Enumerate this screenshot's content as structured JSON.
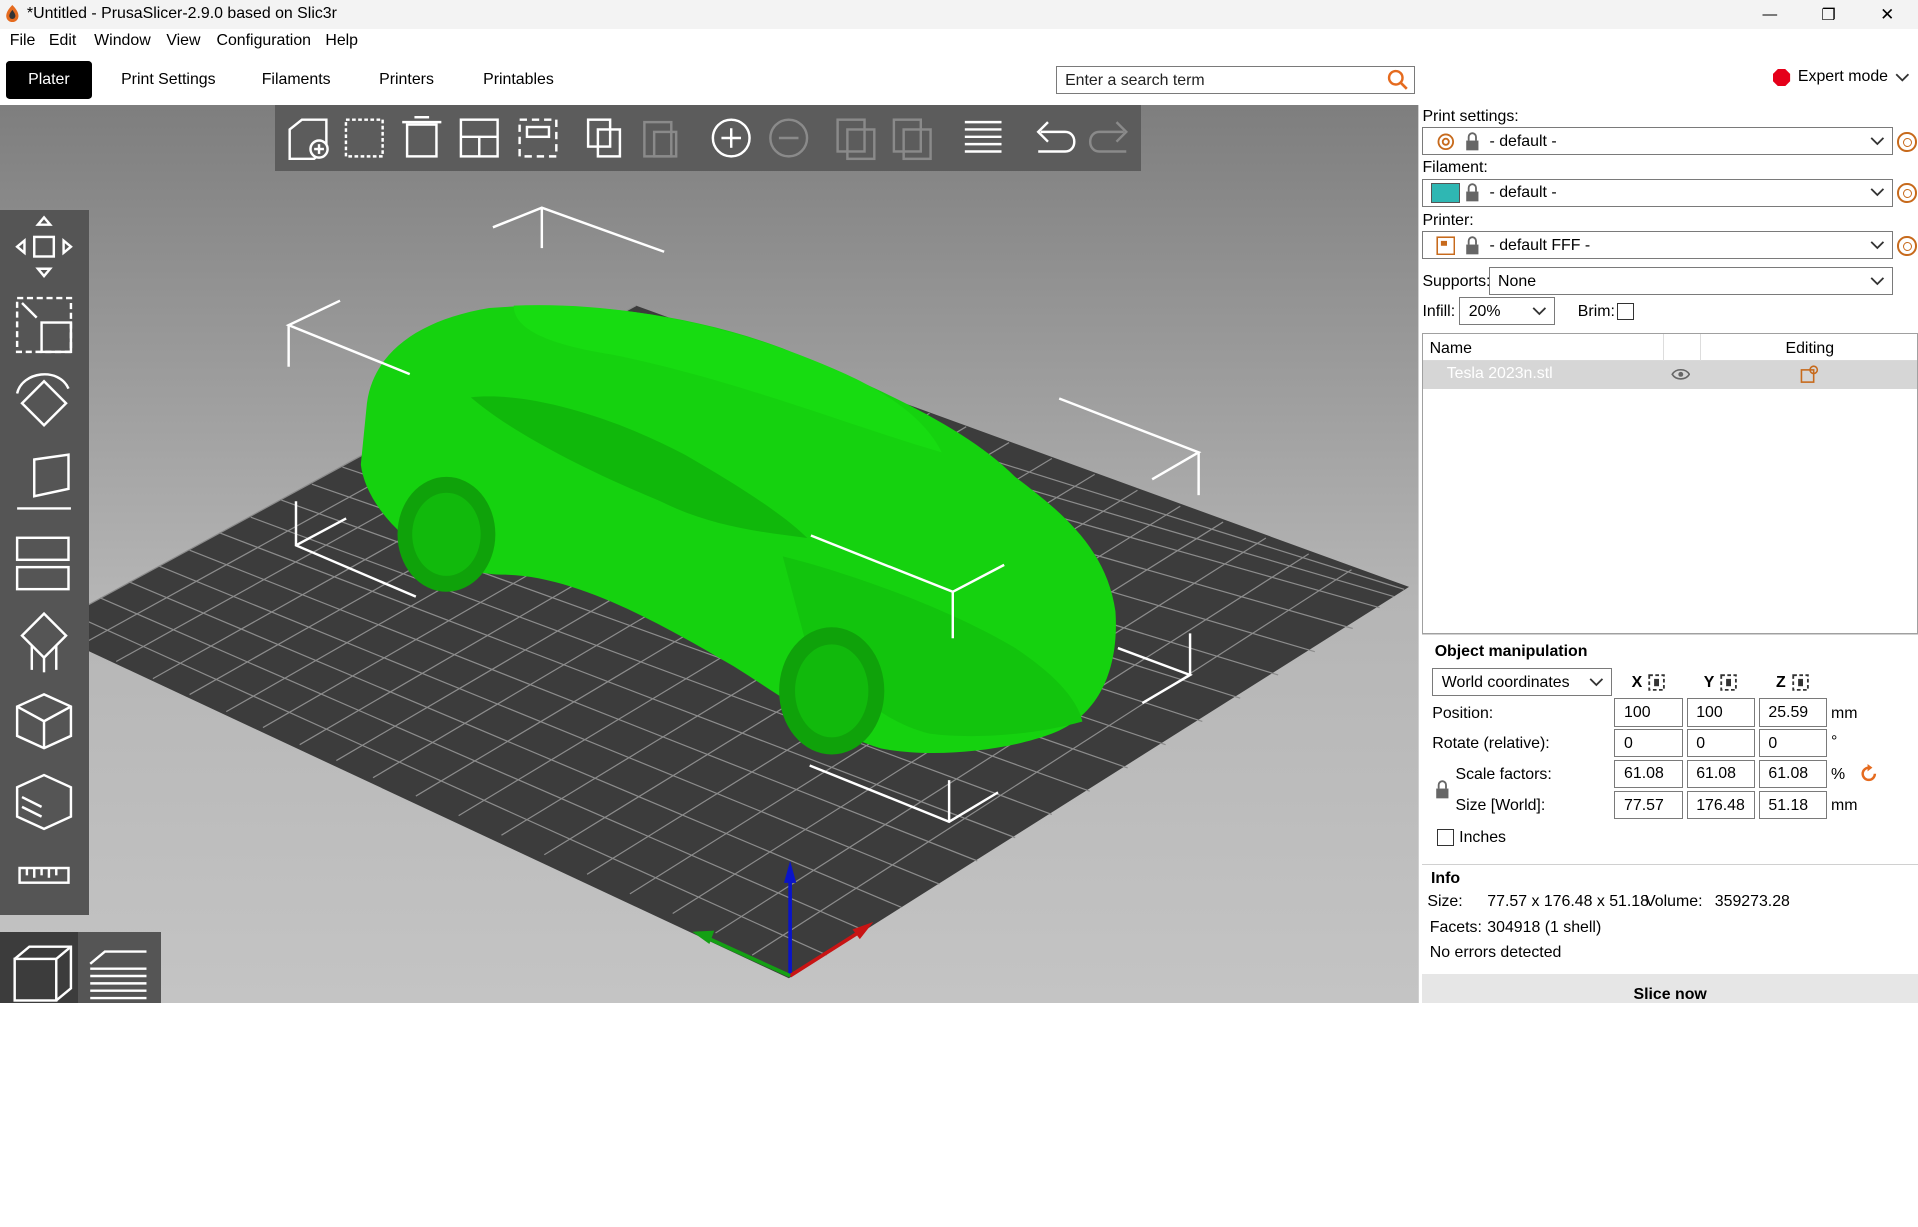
{
  "window": {
    "title": "*Untitled - PrusaSlicer-2.9.0 based on Slic3r",
    "minimize_glyph": "—",
    "restore_glyph": "❐",
    "close_glyph": "✕"
  },
  "menu": [
    "File",
    "Edit",
    "Window",
    "View",
    "Configuration",
    "Help"
  ],
  "tabs": [
    "Plater",
    "Print Settings",
    "Filaments",
    "Printers",
    "Printables"
  ],
  "search": {
    "placeholder": "Enter a search term"
  },
  "mode": {
    "label": "Expert mode",
    "color": "#e5001a"
  },
  "top_toolbar_icons": [
    "add-object-icon",
    "delete-icon",
    "delete-all-icon",
    "arrange-icon",
    "arrange-selection-icon",
    "copy-icon",
    "paste-icon",
    "add-instance-icon",
    "remove-instance-icon",
    "split-to-objects-icon",
    "split-to-parts-icon",
    "variable-layer-height-icon",
    "undo-icon",
    "redo-icon"
  ],
  "left_toolbar_icons": [
    "move-icon",
    "scale-icon",
    "rotate-icon",
    "place-on-face-icon",
    "cut-icon",
    "paint-supports-icon",
    "seam-painting-icon",
    "fdm-supports-icon",
    "measure-icon"
  ],
  "view_buttons": [
    "3d-view-icon",
    "preview-layers-icon"
  ],
  "model": {
    "color": "#15d20f",
    "name": "Tesla 2023n.stl"
  },
  "sidebar": {
    "print_settings_label": "Print settings:",
    "print_settings_value": "- default -",
    "filament_label": "Filament:",
    "filament_value": "- default -",
    "filament_color": "#2fb7b3",
    "printer_label": "Printer:",
    "printer_value": "- default FFF -",
    "supports_label": "Supports:",
    "supports_value": "None",
    "infill_label": "Infill:",
    "infill_value": "20%",
    "brim_label": "Brim:",
    "object_list": {
      "col_name": "Name",
      "col_editing": "Editing",
      "rows": [
        {
          "name": "Tesla 2023n.stl"
        }
      ]
    },
    "object_manipulation": {
      "title": "Object manipulation",
      "coord_system": "World coordinates",
      "axes": [
        "X",
        "Y",
        "Z"
      ],
      "position_label": "Position:",
      "position": [
        "100",
        "100",
        "25.59"
      ],
      "position_unit": "mm",
      "rotate_label": "Rotate (relative):",
      "rotate": [
        "0",
        "0",
        "0"
      ],
      "rotate_unit": "°",
      "scale_label": "Scale factors:",
      "scale": [
        "61.08",
        "61.08",
        "61.08"
      ],
      "scale_unit": "%",
      "size_label": "Size [World]:",
      "size": [
        "77.57",
        "176.48",
        "51.18"
      ],
      "size_unit": "mm",
      "inches_label": "Inches"
    },
    "info": {
      "title": "Info",
      "size_label": "Size:",
      "size_value": "77.57 x 176.48 x 51.18",
      "volume_label": "Volume:",
      "volume_value": "359273.28",
      "facets_label": "Facets:",
      "facets_value": "304918 (1 shell)",
      "errors": "No errors detected"
    },
    "slice_button": "Slice now"
  }
}
